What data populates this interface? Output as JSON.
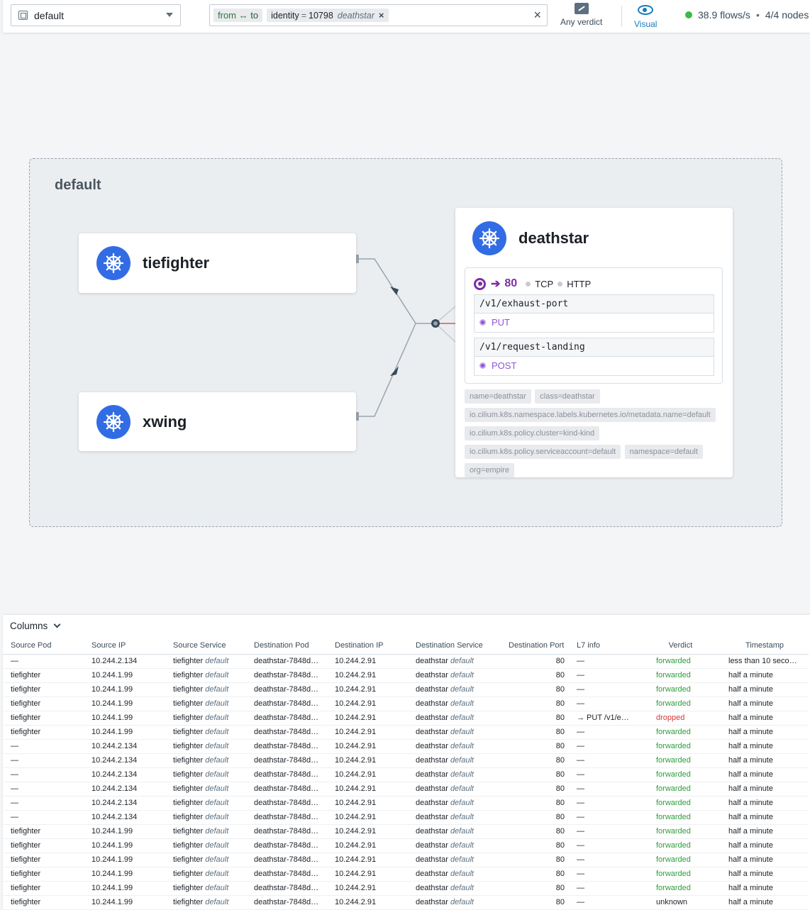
{
  "topbar": {
    "namespace": "default",
    "filter": {
      "direction_from": "from",
      "direction_arrow": "↔",
      "direction_to": "to",
      "key": "identity",
      "eq": "=",
      "value": "10798",
      "label": "deathstar",
      "remove": "×"
    },
    "clear": "×",
    "verdict_label": "Any verdict",
    "visual_label": "Visual",
    "flows_rate": "38.9 flows/s",
    "nodes": "4/4 nodes"
  },
  "graph": {
    "namespace_label": "default",
    "services": [
      {
        "name": "tiefighter"
      },
      {
        "name": "xwing"
      },
      {
        "name": "deathstar"
      }
    ],
    "endpoint": {
      "arrow": "➔",
      "port": "80",
      "protocol_l4": "TCP",
      "protocol_l7": "HTTP",
      "routes": [
        {
          "path": "/v1/exhaust-port",
          "method": "PUT"
        },
        {
          "path": "/v1/request-landing",
          "method": "POST"
        }
      ]
    },
    "labels": [
      "name=deathstar",
      "class=deathstar",
      "io.cilium.k8s.namespace.labels.kubernetes.io/metadata.name=default",
      "io.cilium.k8s.policy.cluster=kind-kind",
      "io.cilium.k8s.policy.serviceaccount=default",
      "namespace=default",
      "org=empire"
    ],
    "colors": {
      "k8s_blue": "#326ce5",
      "port_purple": "#7c2fa6",
      "method_purple": "#8f54d6",
      "edge_dropped": "#db3737"
    }
  },
  "table": {
    "columns_button": "Columns",
    "headers": [
      "Source Pod",
      "Source IP",
      "Source Service",
      "Destination Pod",
      "Destination IP",
      "Destination Service",
      "Destination Port",
      "L7 info",
      "Verdict",
      "Timestamp"
    ],
    "rows": [
      {
        "src_pod": "—",
        "src_ip": "10.244.2.134",
        "src_svc": "tiefighter",
        "src_ns": "default",
        "dst_pod": "deathstar-7848d…",
        "dst_ip": "10.244.2.91",
        "dst_svc": "deathstar",
        "dst_ns": "default",
        "port": "80",
        "l7": "—",
        "verdict": "forwarded",
        "time": "less than 10 seco…"
      },
      {
        "src_pod": "tiefighter",
        "src_ip": "10.244.1.99",
        "src_svc": "tiefighter",
        "src_ns": "default",
        "dst_pod": "deathstar-7848d…",
        "dst_ip": "10.244.2.91",
        "dst_svc": "deathstar",
        "dst_ns": "default",
        "port": "80",
        "l7": "—",
        "verdict": "forwarded",
        "time": "half a minute"
      },
      {
        "src_pod": "tiefighter",
        "src_ip": "10.244.1.99",
        "src_svc": "tiefighter",
        "src_ns": "default",
        "dst_pod": "deathstar-7848d…",
        "dst_ip": "10.244.2.91",
        "dst_svc": "deathstar",
        "dst_ns": "default",
        "port": "80",
        "l7": "—",
        "verdict": "forwarded",
        "time": "half a minute"
      },
      {
        "src_pod": "tiefighter",
        "src_ip": "10.244.1.99",
        "src_svc": "tiefighter",
        "src_ns": "default",
        "dst_pod": "deathstar-7848d…",
        "dst_ip": "10.244.2.91",
        "dst_svc": "deathstar",
        "dst_ns": "default",
        "port": "80",
        "l7": "—",
        "verdict": "forwarded",
        "time": "half a minute"
      },
      {
        "src_pod": "tiefighter",
        "src_ip": "10.244.1.99",
        "src_svc": "tiefighter",
        "src_ns": "default",
        "dst_pod": "deathstar-7848d…",
        "dst_ip": "10.244.2.91",
        "dst_svc": "deathstar",
        "dst_ns": "default",
        "port": "80",
        "l7": "→ PUT /v1/exha…",
        "verdict": "dropped",
        "time": "half a minute"
      },
      {
        "src_pod": "tiefighter",
        "src_ip": "10.244.1.99",
        "src_svc": "tiefighter",
        "src_ns": "default",
        "dst_pod": "deathstar-7848d…",
        "dst_ip": "10.244.2.91",
        "dst_svc": "deathstar",
        "dst_ns": "default",
        "port": "80",
        "l7": "—",
        "verdict": "forwarded",
        "time": "half a minute"
      },
      {
        "src_pod": "—",
        "src_ip": "10.244.2.134",
        "src_svc": "tiefighter",
        "src_ns": "default",
        "dst_pod": "deathstar-7848d…",
        "dst_ip": "10.244.2.91",
        "dst_svc": "deathstar",
        "dst_ns": "default",
        "port": "80",
        "l7": "—",
        "verdict": "forwarded",
        "time": "half a minute"
      },
      {
        "src_pod": "—",
        "src_ip": "10.244.2.134",
        "src_svc": "tiefighter",
        "src_ns": "default",
        "dst_pod": "deathstar-7848d…",
        "dst_ip": "10.244.2.91",
        "dst_svc": "deathstar",
        "dst_ns": "default",
        "port": "80",
        "l7": "—",
        "verdict": "forwarded",
        "time": "half a minute"
      },
      {
        "src_pod": "—",
        "src_ip": "10.244.2.134",
        "src_svc": "tiefighter",
        "src_ns": "default",
        "dst_pod": "deathstar-7848d…",
        "dst_ip": "10.244.2.91",
        "dst_svc": "deathstar",
        "dst_ns": "default",
        "port": "80",
        "l7": "—",
        "verdict": "forwarded",
        "time": "half a minute"
      },
      {
        "src_pod": "—",
        "src_ip": "10.244.2.134",
        "src_svc": "tiefighter",
        "src_ns": "default",
        "dst_pod": "deathstar-7848d…",
        "dst_ip": "10.244.2.91",
        "dst_svc": "deathstar",
        "dst_ns": "default",
        "port": "80",
        "l7": "—",
        "verdict": "forwarded",
        "time": "half a minute"
      },
      {
        "src_pod": "—",
        "src_ip": "10.244.2.134",
        "src_svc": "tiefighter",
        "src_ns": "default",
        "dst_pod": "deathstar-7848d…",
        "dst_ip": "10.244.2.91",
        "dst_svc": "deathstar",
        "dst_ns": "default",
        "port": "80",
        "l7": "—",
        "verdict": "forwarded",
        "time": "half a minute"
      },
      {
        "src_pod": "—",
        "src_ip": "10.244.2.134",
        "src_svc": "tiefighter",
        "src_ns": "default",
        "dst_pod": "deathstar-7848d…",
        "dst_ip": "10.244.2.91",
        "dst_svc": "deathstar",
        "dst_ns": "default",
        "port": "80",
        "l7": "—",
        "verdict": "forwarded",
        "time": "half a minute"
      },
      {
        "src_pod": "tiefighter",
        "src_ip": "10.244.1.99",
        "src_svc": "tiefighter",
        "src_ns": "default",
        "dst_pod": "deathstar-7848d…",
        "dst_ip": "10.244.2.91",
        "dst_svc": "deathstar",
        "dst_ns": "default",
        "port": "80",
        "l7": "—",
        "verdict": "forwarded",
        "time": "half a minute"
      },
      {
        "src_pod": "tiefighter",
        "src_ip": "10.244.1.99",
        "src_svc": "tiefighter",
        "src_ns": "default",
        "dst_pod": "deathstar-7848d…",
        "dst_ip": "10.244.2.91",
        "dst_svc": "deathstar",
        "dst_ns": "default",
        "port": "80",
        "l7": "—",
        "verdict": "forwarded",
        "time": "half a minute"
      },
      {
        "src_pod": "tiefighter",
        "src_ip": "10.244.1.99",
        "src_svc": "tiefighter",
        "src_ns": "default",
        "dst_pod": "deathstar-7848d…",
        "dst_ip": "10.244.2.91",
        "dst_svc": "deathstar",
        "dst_ns": "default",
        "port": "80",
        "l7": "—",
        "verdict": "forwarded",
        "time": "half a minute"
      },
      {
        "src_pod": "tiefighter",
        "src_ip": "10.244.1.99",
        "src_svc": "tiefighter",
        "src_ns": "default",
        "dst_pod": "deathstar-7848d…",
        "dst_ip": "10.244.2.91",
        "dst_svc": "deathstar",
        "dst_ns": "default",
        "port": "80",
        "l7": "—",
        "verdict": "forwarded",
        "time": "half a minute"
      },
      {
        "src_pod": "tiefighter",
        "src_ip": "10.244.1.99",
        "src_svc": "tiefighter",
        "src_ns": "default",
        "dst_pod": "deathstar-7848d…",
        "dst_ip": "10.244.2.91",
        "dst_svc": "deathstar",
        "dst_ns": "default",
        "port": "80",
        "l7": "—",
        "verdict": "forwarded",
        "time": "half a minute"
      },
      {
        "src_pod": "tiefighter",
        "src_ip": "10.244.1.99",
        "src_svc": "tiefighter",
        "src_ns": "default",
        "dst_pod": "deathstar-7848d…",
        "dst_ip": "10.244.2.91",
        "dst_svc": "deathstar",
        "dst_ns": "default",
        "port": "80",
        "l7": "—",
        "verdict": "unknown",
        "time": "half a minute"
      }
    ]
  }
}
